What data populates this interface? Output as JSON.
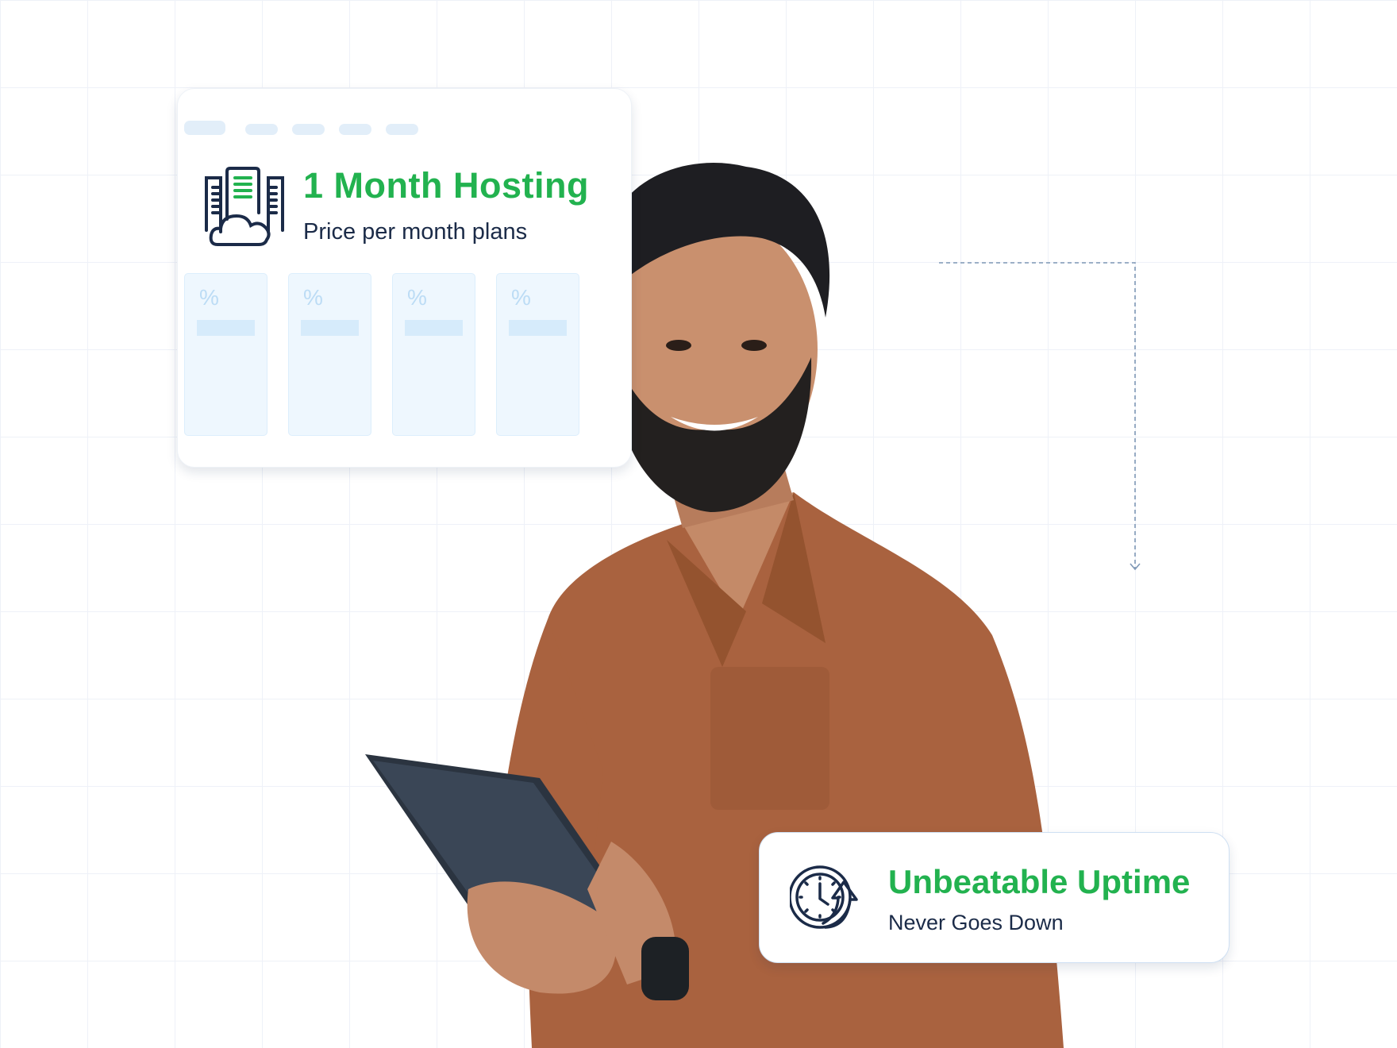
{
  "hosting_card": {
    "title": "1 Month Hosting",
    "subtitle": "Price per month plans",
    "icon": "server-cloud-icon",
    "plans": [
      {
        "symbol": "%"
      },
      {
        "symbol": "%"
      },
      {
        "symbol": "%"
      },
      {
        "symbol": "%"
      }
    ]
  },
  "uptime_card": {
    "title": "Unbeatable Uptime",
    "subtitle": "Never Goes Down",
    "icon": "clock-refresh-icon"
  },
  "colors": {
    "accent_green": "#22b24f",
    "text_navy": "#1b2b48",
    "placeholder_blue": "#eef7fe",
    "shirt": "#a9623f"
  }
}
